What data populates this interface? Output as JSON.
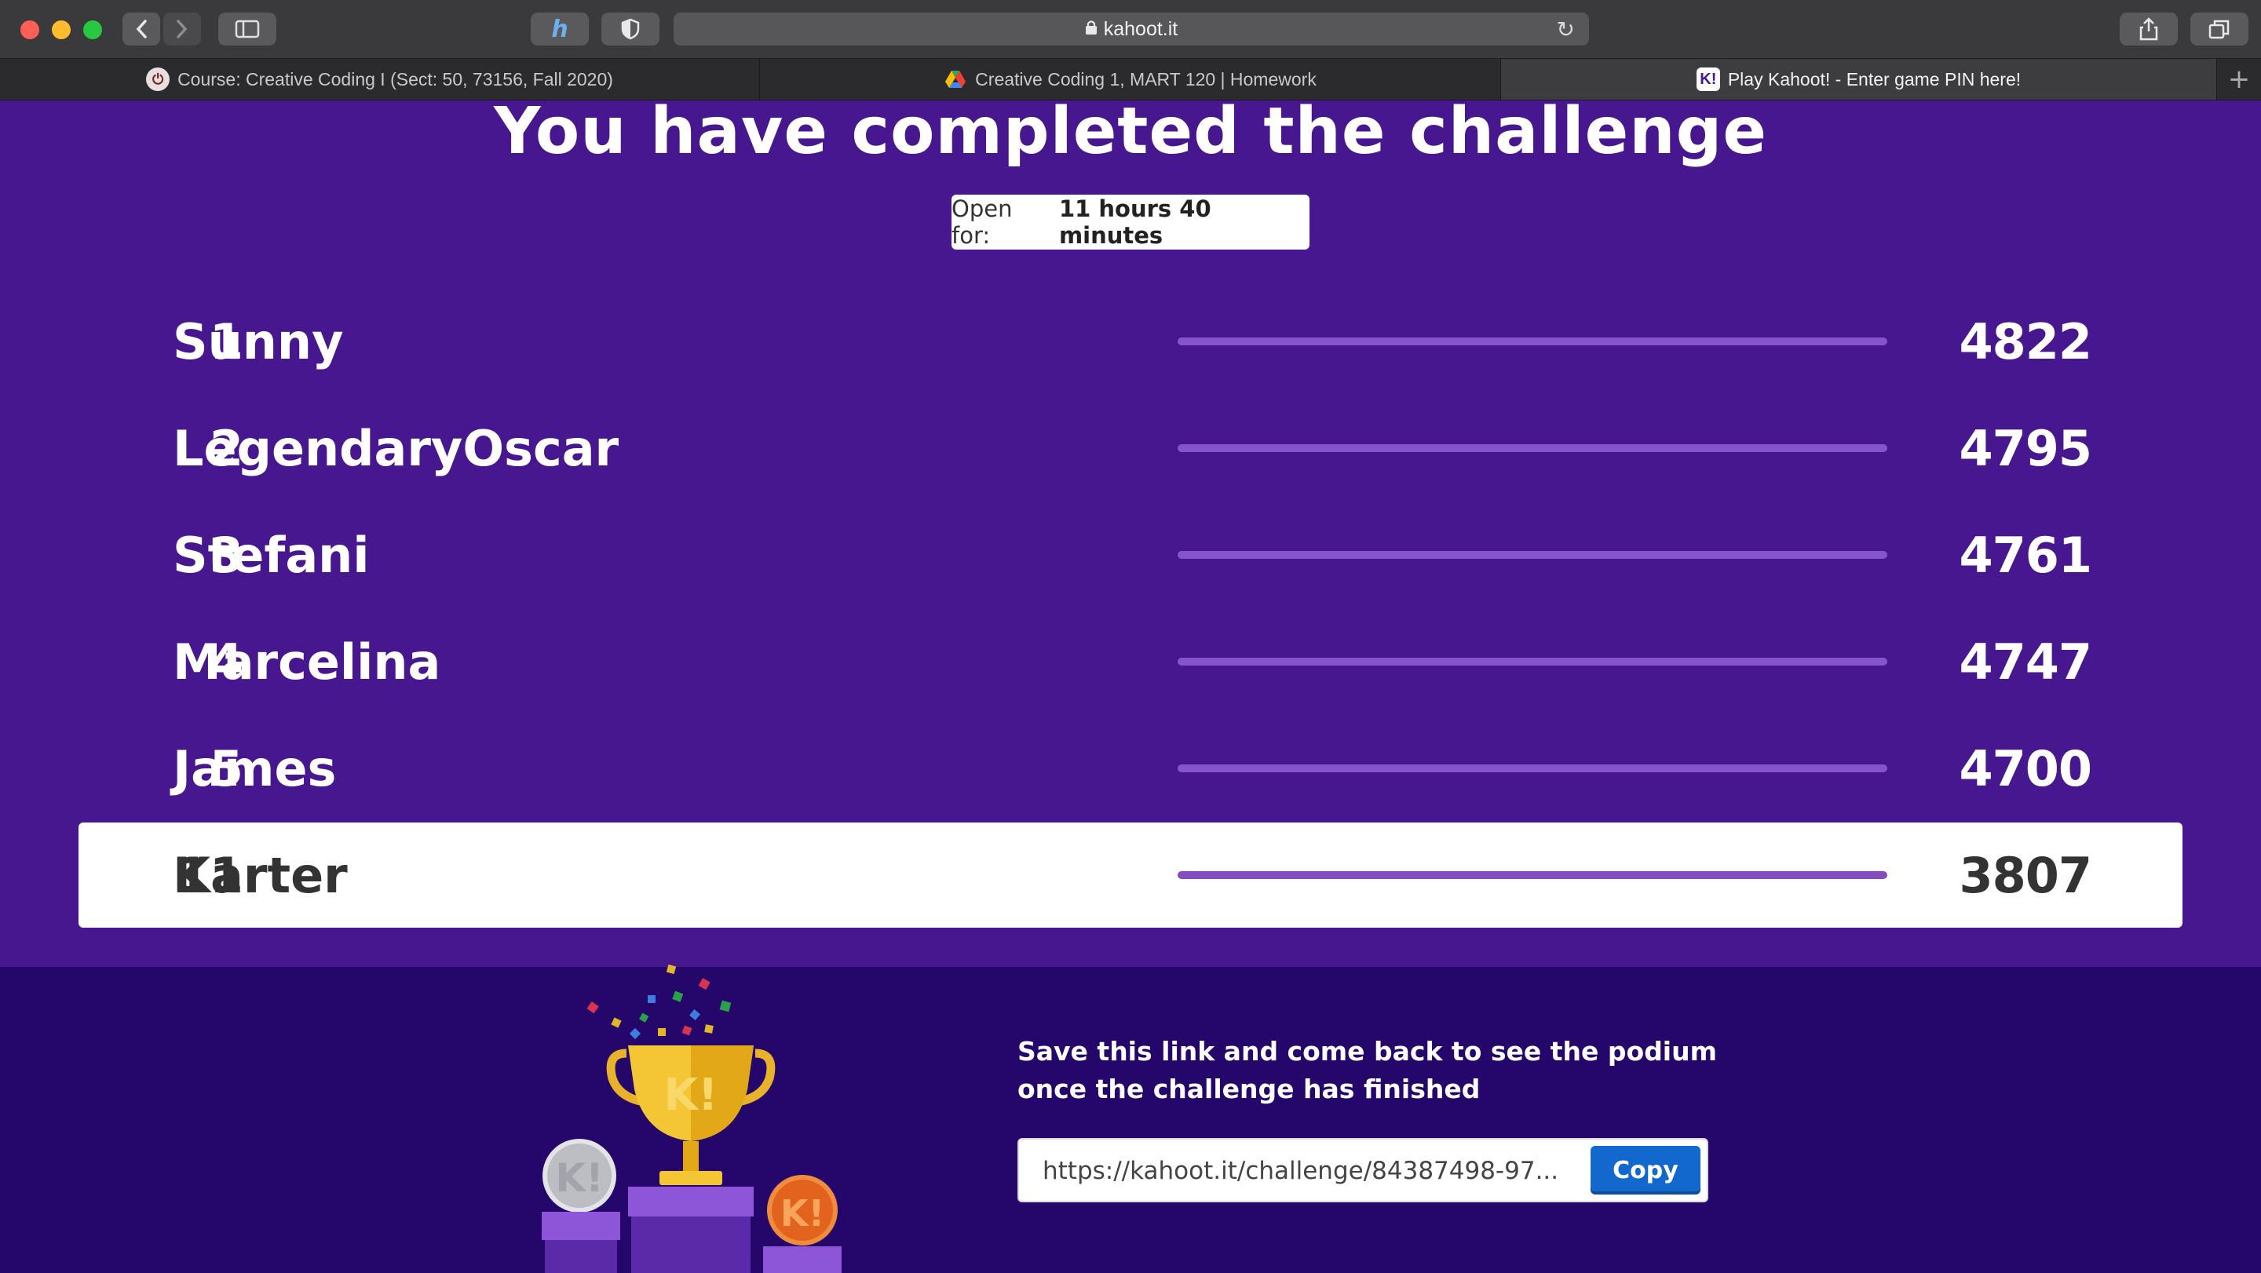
{
  "browser": {
    "url": "kahoot.it",
    "tabs": [
      {
        "label": "Course: Creative Coding I (Sect: 50, 73156, Fall 2020)",
        "active": false
      },
      {
        "label": "Creative Coding 1, MART 120 | Homework",
        "active": false
      },
      {
        "label": "Play Kahoot! - Enter game PIN here!",
        "active": true
      }
    ]
  },
  "page": {
    "title": "You have completed the challenge",
    "open_for_label": "Open for:",
    "open_for_value": "11 hours 40 minutes"
  },
  "leaderboard": [
    {
      "rank": "1",
      "name": "Sunny",
      "score": "4822"
    },
    {
      "rank": "2",
      "name": "LegendaryOscar",
      "score": "4795"
    },
    {
      "rank": "3",
      "name": "Stefani",
      "score": "4761"
    },
    {
      "rank": "4",
      "name": "Marcelina",
      "score": "4747"
    },
    {
      "rank": "5",
      "name": "James",
      "score": "4700"
    },
    {
      "rank": "11",
      "name": "Karter",
      "score": "3807"
    }
  ],
  "footer": {
    "save_text_line1": "Save this link and come back to see the podium",
    "save_text_line2": "once the challenge has finished",
    "link": "https://kahoot.it/challenge/84387498-97...",
    "copy_label": "Copy"
  },
  "colors": {
    "background": "#46178f",
    "footer": "#25076b",
    "bar": "#8654cc",
    "copy_button": "#1368ce"
  }
}
